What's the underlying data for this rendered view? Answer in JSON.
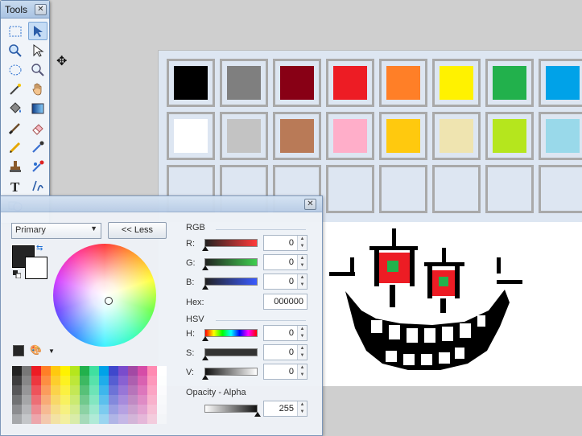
{
  "tools_window": {
    "title": "Tools",
    "close_glyph": "✕",
    "tools": [
      {
        "name": "rectangle-select-icon",
        "active": false
      },
      {
        "name": "move-selection-icon",
        "active": true
      },
      {
        "name": "zoom-icon",
        "active": false
      },
      {
        "name": "move-selected-icon",
        "active": false
      },
      {
        "name": "ellipse-select-icon",
        "active": false
      },
      {
        "name": "zoom-magnifier-icon",
        "active": false
      },
      {
        "name": "magic-wand-icon",
        "active": false
      },
      {
        "name": "pan-hand-icon",
        "active": false
      },
      {
        "name": "paint-bucket-icon",
        "active": false
      },
      {
        "name": "gradient-icon",
        "active": false
      },
      {
        "name": "paintbrush-icon",
        "active": false
      },
      {
        "name": "eraser-icon",
        "active": false
      },
      {
        "name": "pencil-icon",
        "active": false
      },
      {
        "name": "color-picker-icon",
        "active": false
      },
      {
        "name": "clone-stamp-icon",
        "active": false
      },
      {
        "name": "recolor-icon",
        "active": false
      },
      {
        "name": "text-icon",
        "active": false
      },
      {
        "name": "line-curve-icon",
        "active": false
      },
      {
        "name": "shapes-icon",
        "active": false
      }
    ]
  },
  "colors_window": {
    "close_glyph": "✕",
    "mode_select": "Primary",
    "less_button": "<< Less",
    "primary_color": "#242424",
    "secondary_color": "#ffffff",
    "rgb_label": "RGB",
    "hsv_label": "HSV",
    "r_label": "R:",
    "g_label": "G:",
    "b_label": "B:",
    "h_label": "H:",
    "s_label": "S:",
    "v_label": "V:",
    "hex_label": "Hex:",
    "r_value": "0",
    "g_value": "0",
    "b_value": "0",
    "hex_value": "000000",
    "h_value": "0",
    "s_value": "0",
    "v_value": "0",
    "opacity_label": "Opacity - Alpha",
    "alpha_value": "255"
  },
  "canvas_palette": {
    "row1": [
      "#000000",
      "#7f7f7f",
      "#880015",
      "#ed1c24",
      "#ff7f27",
      "#fff200",
      "#22b14c",
      "#00a2e8"
    ],
    "row2": [
      "#ffffff",
      "#c3c3c3",
      "#b97a57",
      "#ffaec9",
      "#ffc90e",
      "#efe4b0",
      "#b5e61d",
      "#99d9ea"
    ],
    "row3": [
      "",
      "",
      "",
      "",
      "",
      "",
      "",
      ""
    ]
  }
}
